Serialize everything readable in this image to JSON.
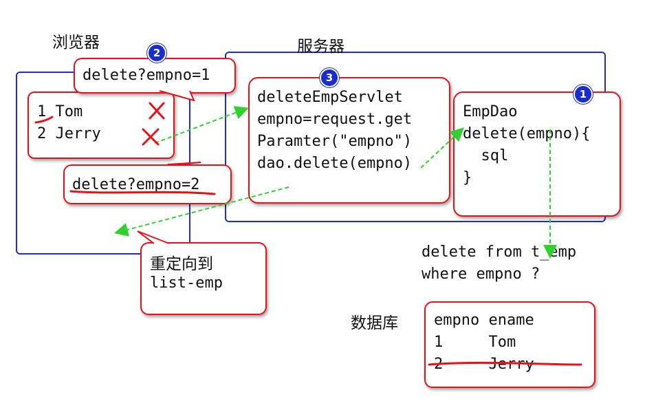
{
  "labels": {
    "browser": "浏览器",
    "server": "服务器",
    "database": "数据库"
  },
  "badges": {
    "dao": "1",
    "request": "2",
    "servlet": "3"
  },
  "request_box": {
    "text": "delete?empno=1"
  },
  "browser_list": {
    "lines": [
      "1 Tom",
      "2 Jerry"
    ]
  },
  "delete2_box": {
    "text": "delete?empno=2"
  },
  "servlet_box": {
    "lines": [
      "deleteEmpServlet",
      "empno=request.get",
      "Paramter(\"empno\")",
      "dao.delete(empno)"
    ]
  },
  "dao_box": {
    "lines": [
      "EmpDao",
      "delete(empno){",
      "  sql",
      "}"
    ]
  },
  "sql_text": {
    "lines": [
      "delete from t_emp",
      "where empno ?"
    ]
  },
  "redirect_box": {
    "lines": [
      "重定向到",
      "list-emp"
    ]
  },
  "db_table": {
    "header": "empno ename",
    "rows": [
      "1     Tom",
      "2     Jerry"
    ]
  },
  "colors": {
    "frame": "#1f2bd6",
    "callout": "#e8111a",
    "arrow": "#2fd12f",
    "badge": "#1a2ccc"
  }
}
